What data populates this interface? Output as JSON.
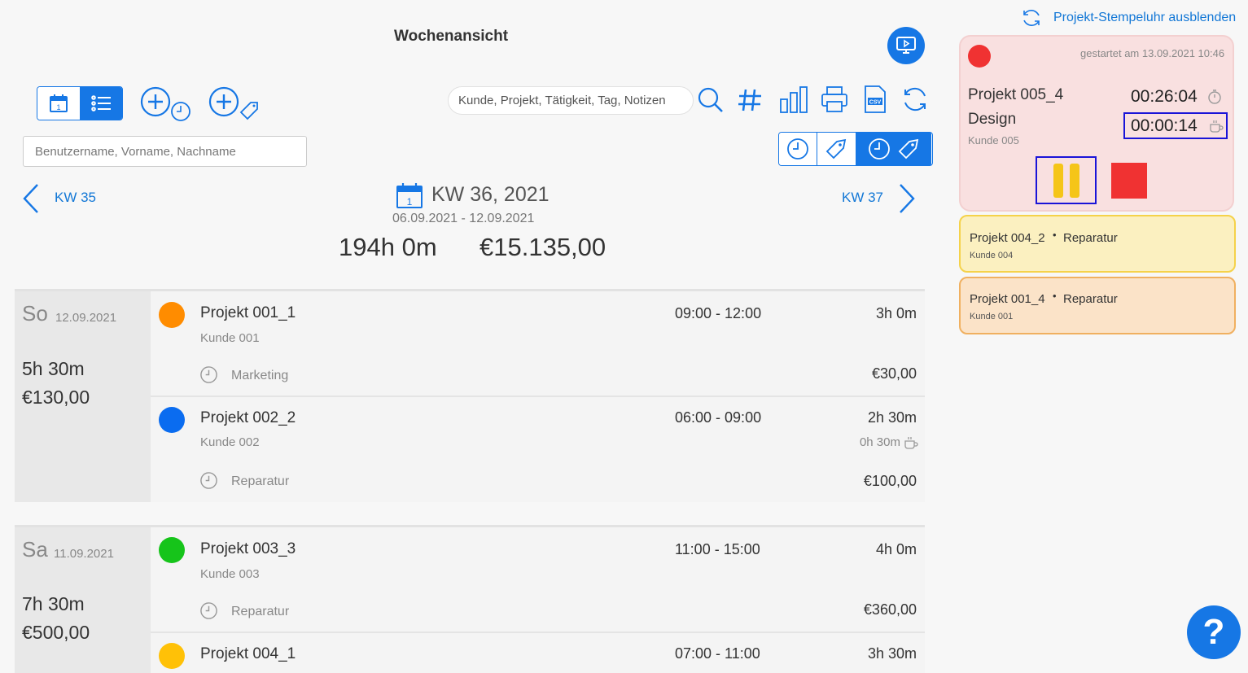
{
  "header": {
    "title": "Wochenansicht",
    "search_placeholder": "Kunde, Projekt, Tätigkeit, Tag, Notizen",
    "user_placeholder": "Benutzername, Vorname, Nachname"
  },
  "week": {
    "prev": "KW 35",
    "next": "KW 37",
    "current": "KW 36, 2021",
    "calendar_day": "1",
    "range": "06.09.2021 - 12.09.2021",
    "total_hours": "194h 0m",
    "total_amount": "€15.135,00"
  },
  "days": [
    {
      "name": "So",
      "date": "12.09.2021",
      "hours": "5h 30m",
      "amount": "€130,00",
      "entries": [
        {
          "project": "Projekt 001_1",
          "customer": "Kunde 001",
          "activity": "Marketing",
          "time": "09:00 - 12:00",
          "duration": "3h 0m",
          "price": "€30,00",
          "color": "#ff8c00"
        },
        {
          "project": "Projekt 002_2",
          "customer": "Kunde 002",
          "activity": "Reparatur",
          "time": "06:00 - 09:00",
          "duration": "2h 30m",
          "pause": "0h 30m",
          "price": "€100,00",
          "color": "#0a6cf0"
        }
      ]
    },
    {
      "name": "Sa",
      "date": "11.09.2021",
      "hours": "7h 30m",
      "amount": "€500,00",
      "entries": [
        {
          "project": "Projekt 003_3",
          "customer": "Kunde 003",
          "activity": "Reparatur",
          "time": "11:00 - 15:00",
          "duration": "4h 0m",
          "price": "€360,00",
          "color": "#16c41a"
        },
        {
          "project": "Projekt 004_1",
          "time": "07:00 - 11:00",
          "duration": "3h 30m",
          "color": "#ffc107"
        }
      ]
    }
  ],
  "stopwatch": {
    "hide_link": "Projekt-Stempeluhr ausblenden",
    "started": "gestartet am 13.09.2021 10:46",
    "project": "Projekt 005_4",
    "activity": "Design",
    "customer": "Kunde 005",
    "elapsed": "00:26:04",
    "pause": "00:00:14",
    "colors": {
      "card": "#f9e0e0",
      "record": "#f03232",
      "pause_btn": "#f5c518",
      "stop_btn": "#f03232"
    }
  },
  "recent": [
    {
      "project": "Projekt 004_2",
      "activity": "Reparatur",
      "customer": "Kunde 004",
      "bg": "#fbf0c0",
      "border": "#f5d24a"
    },
    {
      "project": "Projekt 001_4",
      "activity": "Reparatur",
      "customer": "Kunde 001",
      "bg": "#fbe3c8",
      "border": "#f0b060"
    }
  ],
  "help": {
    "label": "?"
  },
  "colors": {
    "accent": "#1677e5"
  }
}
